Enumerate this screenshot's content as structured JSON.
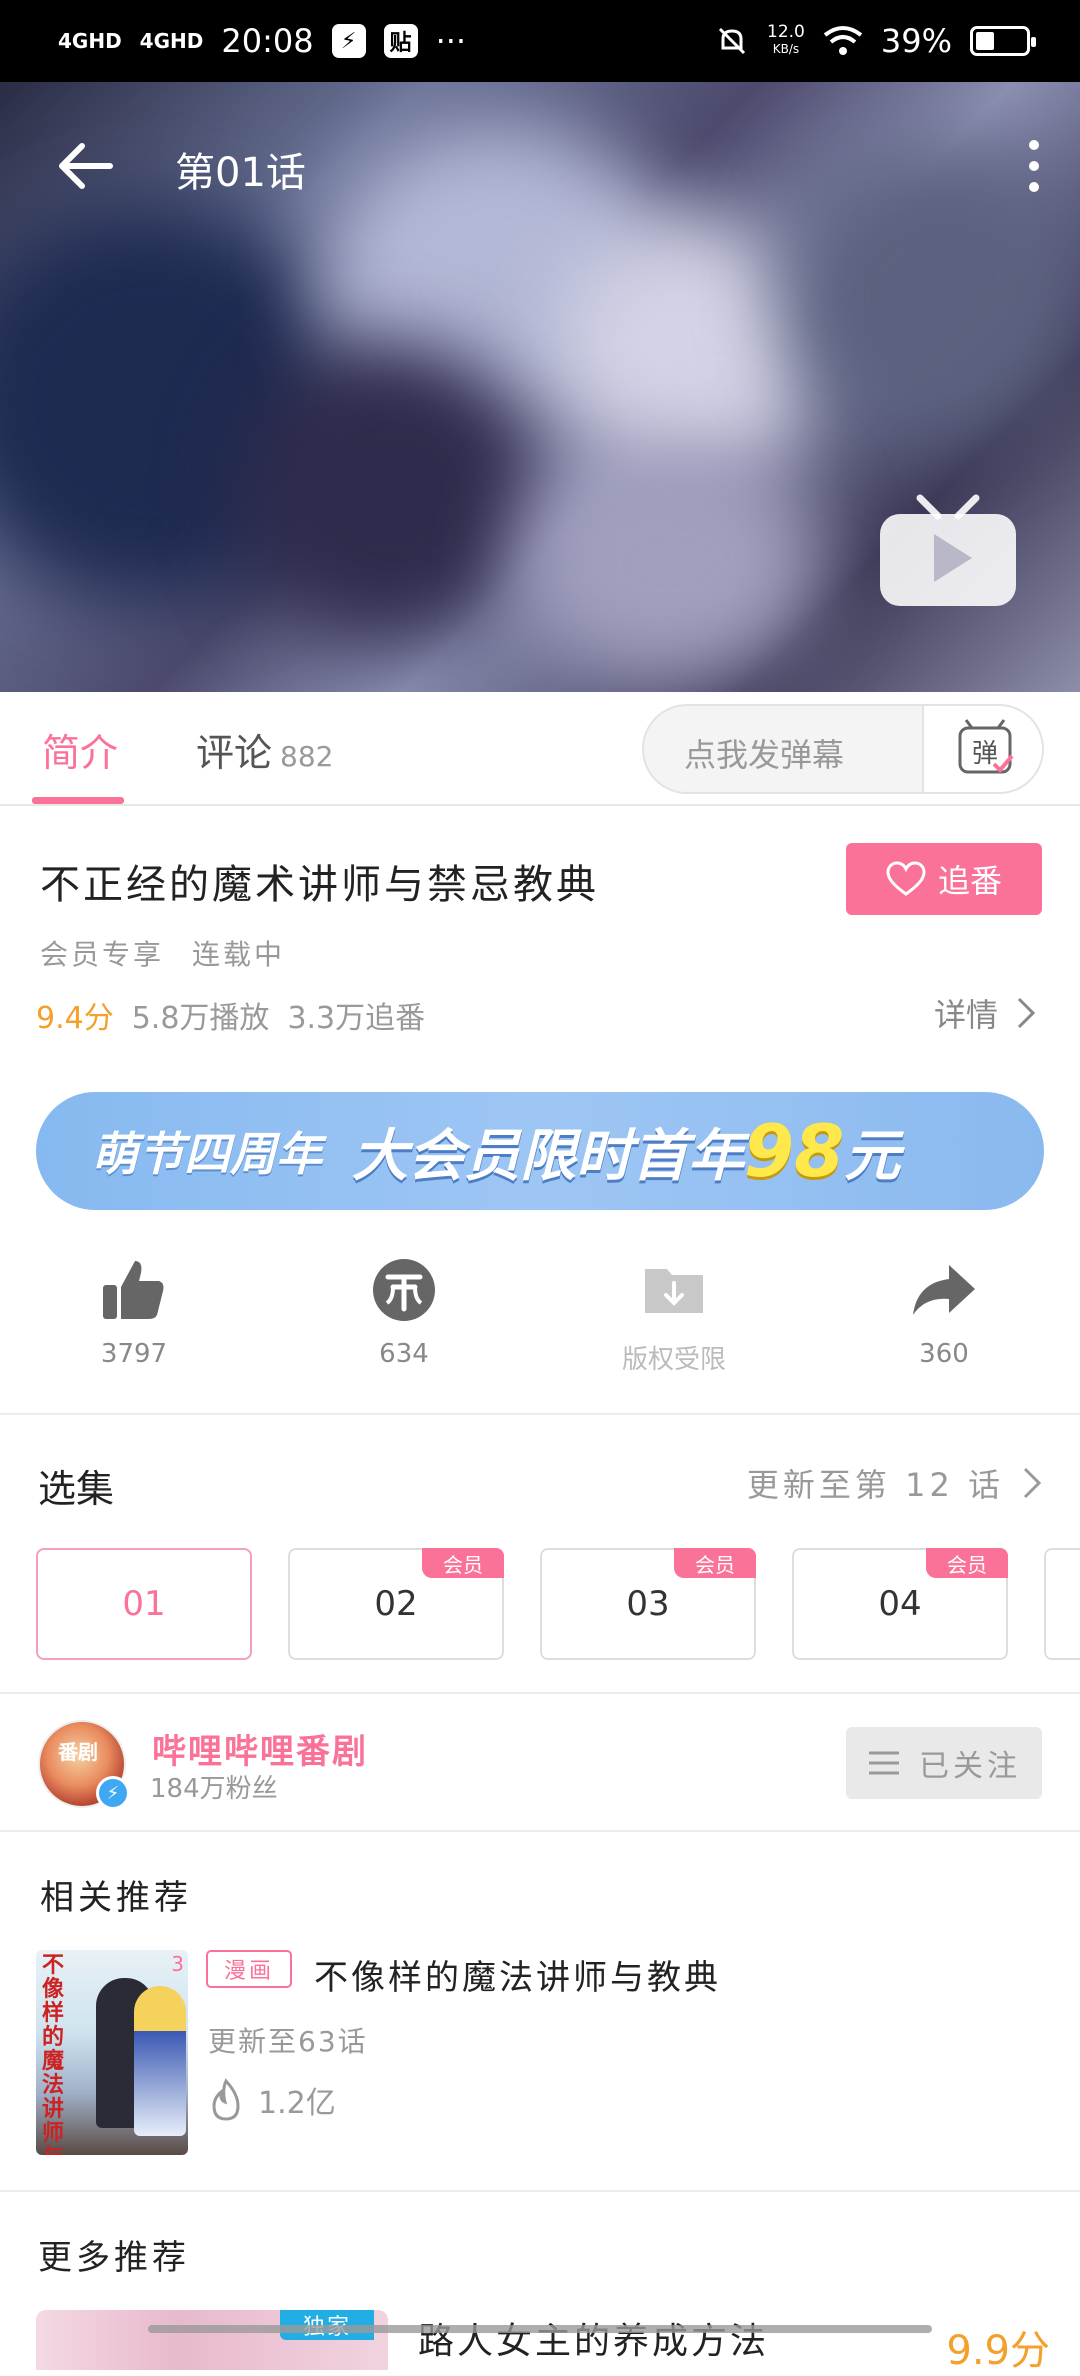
{
  "status_bar": {
    "signal1": "4GHD",
    "signal2": "4GHD",
    "time": "20:08",
    "badge1": "⚡",
    "badge2": "贴",
    "dots": "···",
    "net_speed": "12.0",
    "net_unit": "KB/s",
    "battery": "39%",
    "battery_level": 0.39
  },
  "player": {
    "title": "第01话"
  },
  "tabs": {
    "intro": "简介",
    "comments": "评论",
    "comment_count": "882",
    "danmaku_placeholder": "点我发弹幕",
    "danmaku_btn": "弹"
  },
  "info": {
    "title": "不正经的魔术讲师与禁忌教典",
    "follow_label": "追番",
    "tag_vip": "会员专享",
    "tag_status": "连载中",
    "score": "9.4分",
    "plays": "5.8万播放",
    "follows": "3.3万追番",
    "details": "详情"
  },
  "banner": {
    "part1": "萌节四周年",
    "part2": "大会员限时首年",
    "price": "98",
    "unit": "元"
  },
  "actions": {
    "like_count": "3797",
    "coin_count": "634",
    "download_label": "版权受限",
    "share_count": "360"
  },
  "episodes": {
    "heading": "选集",
    "update_text": "更新至第 12 话",
    "items": [
      {
        "label": "01",
        "vip": ""
      },
      {
        "label": "02",
        "vip": "会员"
      },
      {
        "label": "03",
        "vip": "会员"
      },
      {
        "label": "04",
        "vip": "会员"
      }
    ]
  },
  "uploader": {
    "avatar_text": "番剧",
    "name": "哔哩哔哩番剧",
    "fans": "184万粉丝",
    "followed_label": "已关注"
  },
  "related": {
    "heading": "相关推荐",
    "cover_text": "不像样的魔法讲师与教典",
    "cover_num": "3",
    "tag": "漫画",
    "title": "不像样的魔法讲师与教典",
    "update": "更新至63话",
    "heat": "1.2亿"
  },
  "more": {
    "heading": "更多推荐",
    "badge": "独家",
    "title": "路人女主的养成方法",
    "score": "9.9分"
  },
  "colors": {
    "accent": "#fb7299",
    "score": "#f4a02c",
    "banner": "#9ec6f4"
  }
}
